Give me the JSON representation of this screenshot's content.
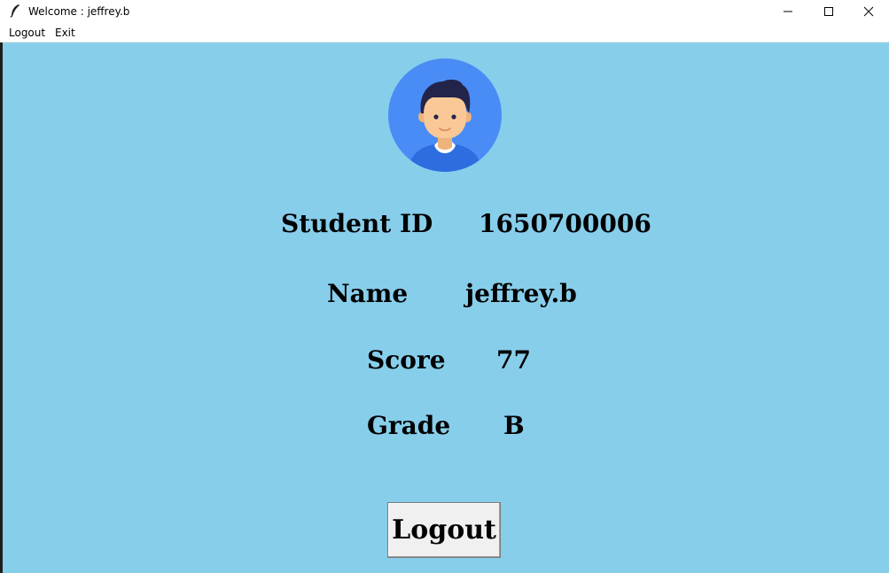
{
  "window": {
    "title": "Welcome : jeffrey.b"
  },
  "menu": {
    "items": [
      {
        "label": "Logout"
      },
      {
        "label": "Exit"
      }
    ]
  },
  "profile": {
    "avatar_icon": "user-avatar-icon",
    "rows": [
      {
        "label": "Student ID",
        "value": "1650700006"
      },
      {
        "label": "Name",
        "value": "jeffrey.b"
      },
      {
        "label": "Score",
        "value": "77"
      },
      {
        "label": "Grade",
        "value": "B"
      }
    ]
  },
  "actions": {
    "logout_label": "Logout"
  },
  "colors": {
    "background": "#87ceeb",
    "avatar_circle": "#4a8cf5",
    "hair": "#23244a",
    "skin": "#f9c896",
    "shirt": "#2d6de0"
  }
}
